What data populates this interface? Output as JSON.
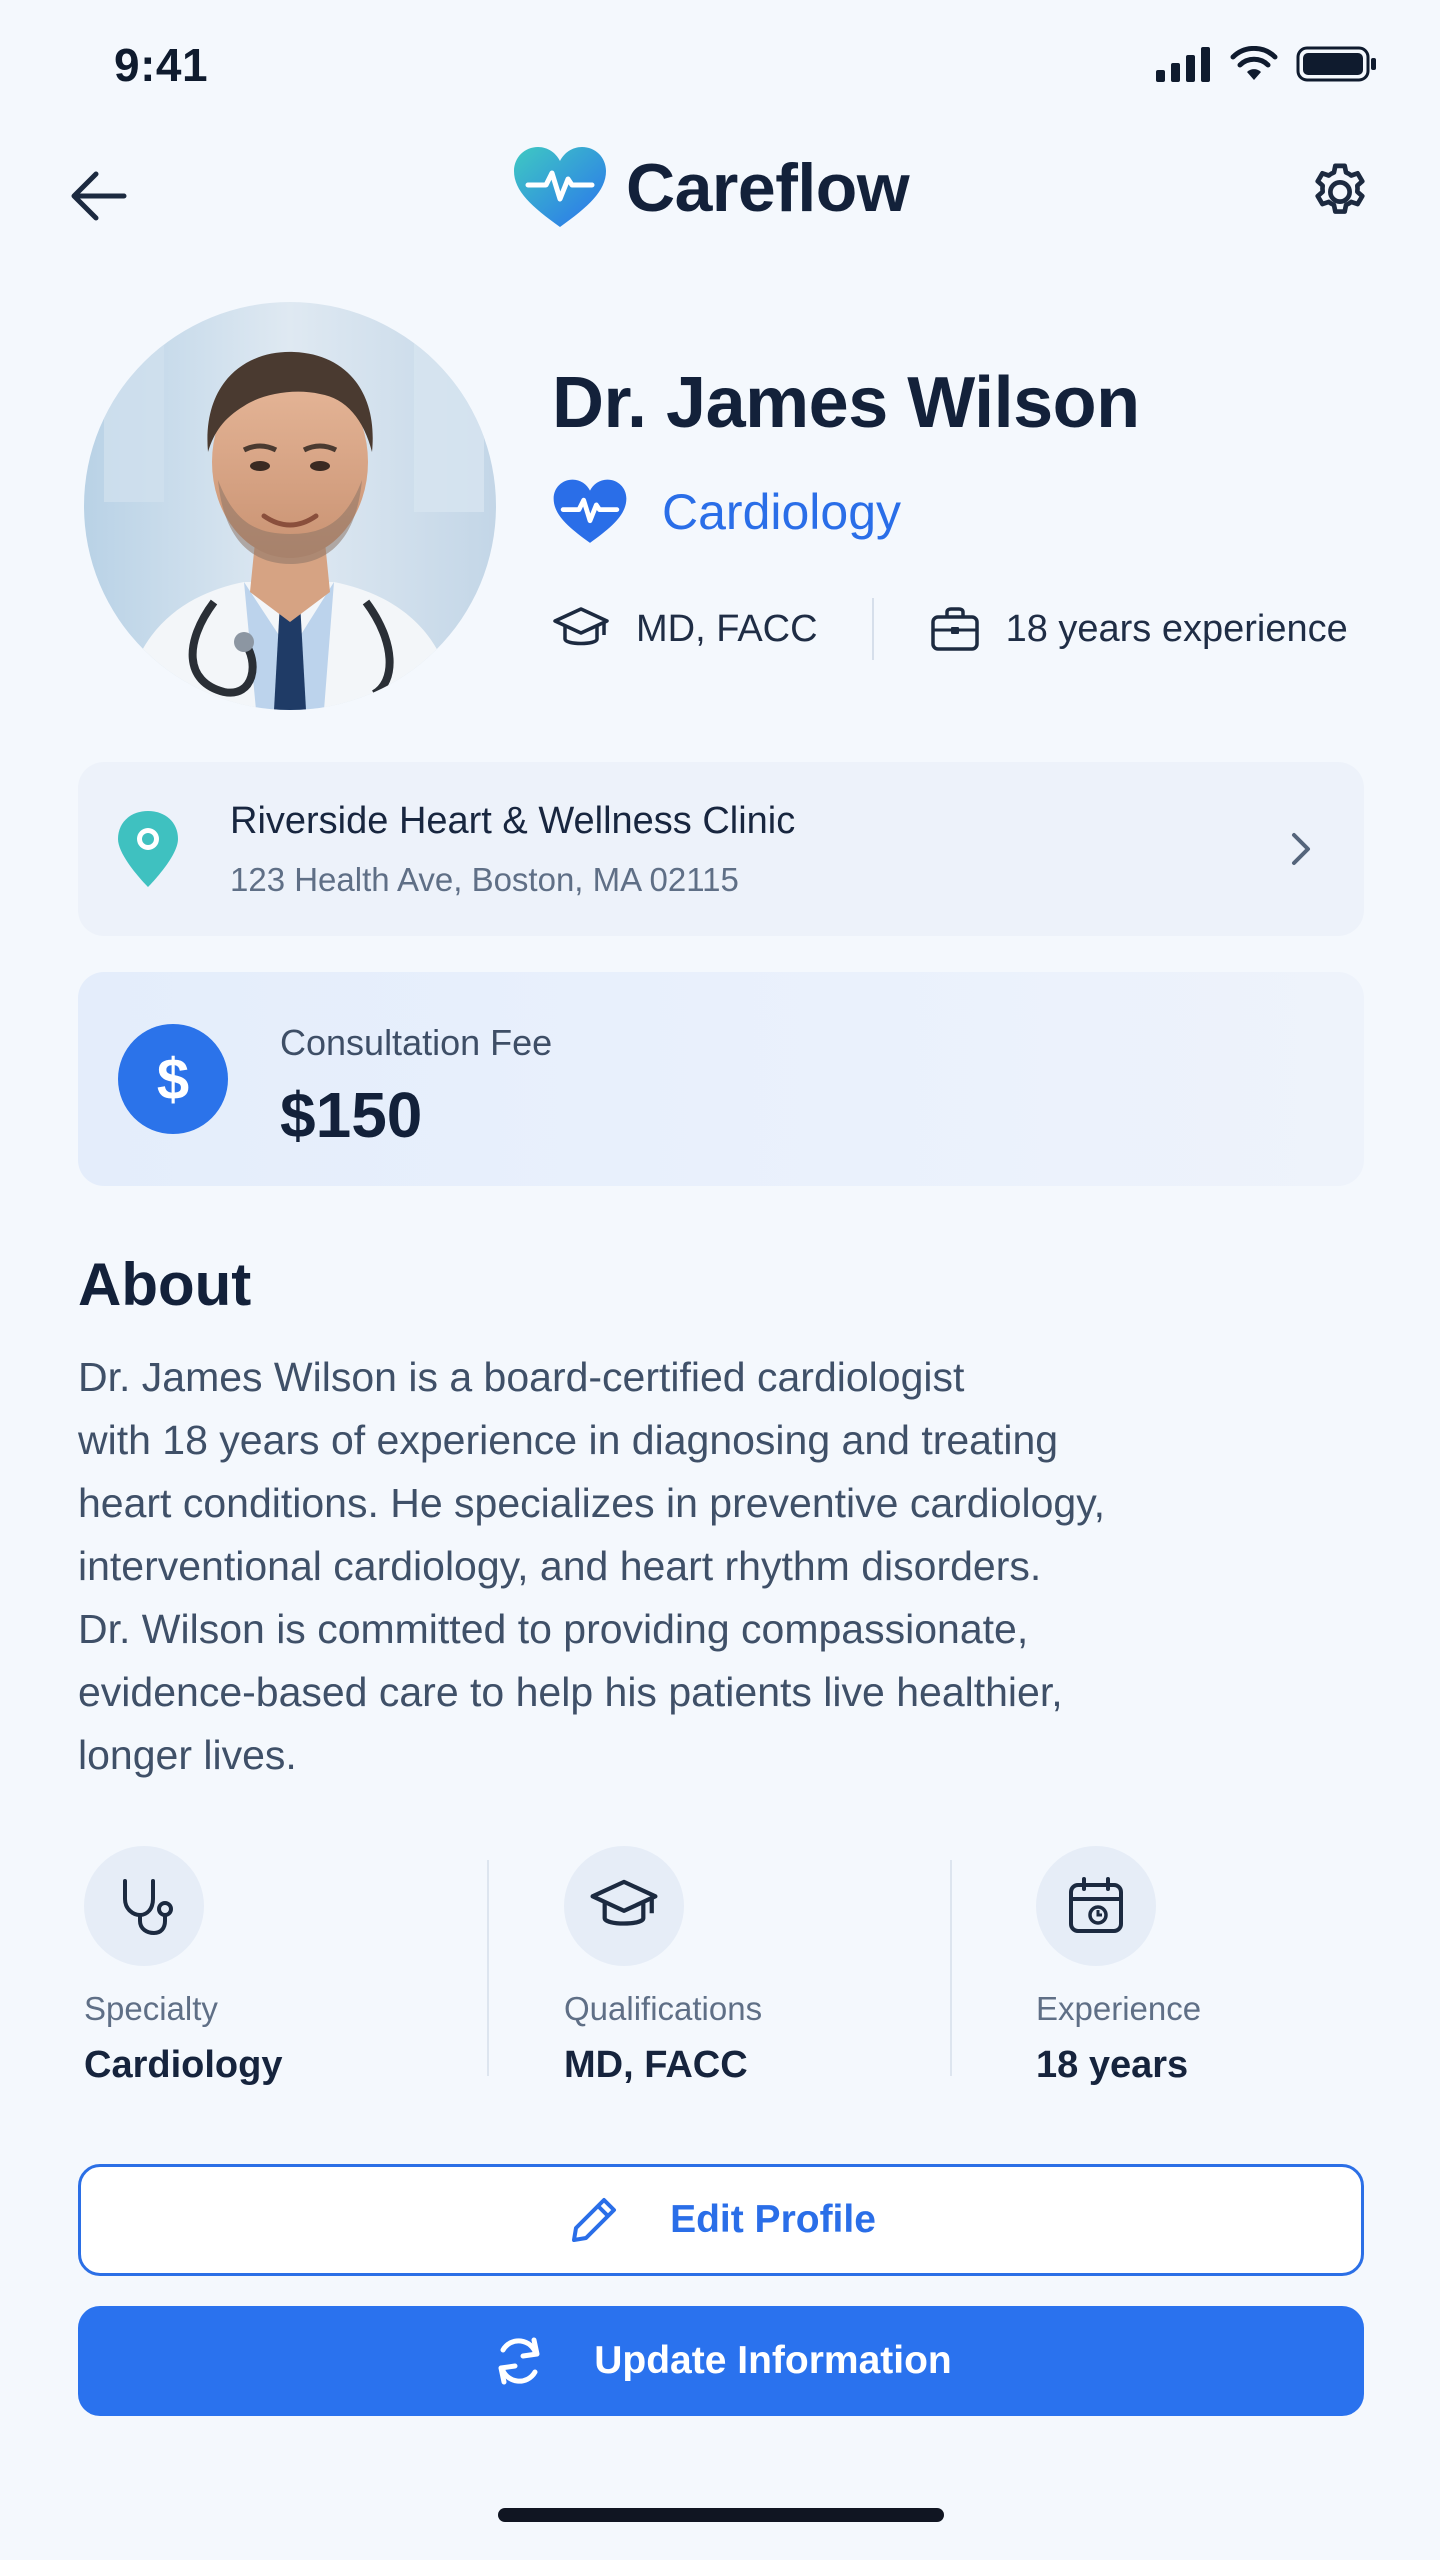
{
  "status_bar": {
    "time": "9:41"
  },
  "header": {
    "brand": "Careflow"
  },
  "profile": {
    "name": "Dr. James Wilson",
    "specialty": "Cardiology",
    "credentials": "MD, FACC",
    "experience": "18 years experience"
  },
  "clinic": {
    "name": "Riverside Heart & Wellness Clinic",
    "address": "123 Health Ave, Boston, MA 02115"
  },
  "fee": {
    "label": "Consultation Fee",
    "value": "$150",
    "icon_glyph": "$"
  },
  "about": {
    "title": "About",
    "lines": [
      "Dr. James Wilson is a board-certified cardiologist",
      "with 18 years of experience in diagnosing and treating",
      "heart conditions. He specializes in preventive cardiology,",
      "interventional cardiology, and heart rhythm disorders.",
      "Dr. Wilson is committed to providing compassionate,",
      "evidence-based care to help his patients live healthier,",
      "longer lives."
    ]
  },
  "stats": [
    {
      "label": "Specialty",
      "value": "Cardiology",
      "icon": "stethoscope-icon"
    },
    {
      "label": "Qualifications",
      "value": "MD, FACC",
      "icon": "graduation-cap-icon"
    },
    {
      "label": "Experience",
      "value": "18 years",
      "icon": "calendar-icon"
    }
  ],
  "actions": {
    "edit": "Edit Profile",
    "update": "Update Information"
  },
  "colors": {
    "accent": "#2a72ee",
    "brand_teal": "#3fc1c0",
    "text_dark": "#13213a"
  }
}
